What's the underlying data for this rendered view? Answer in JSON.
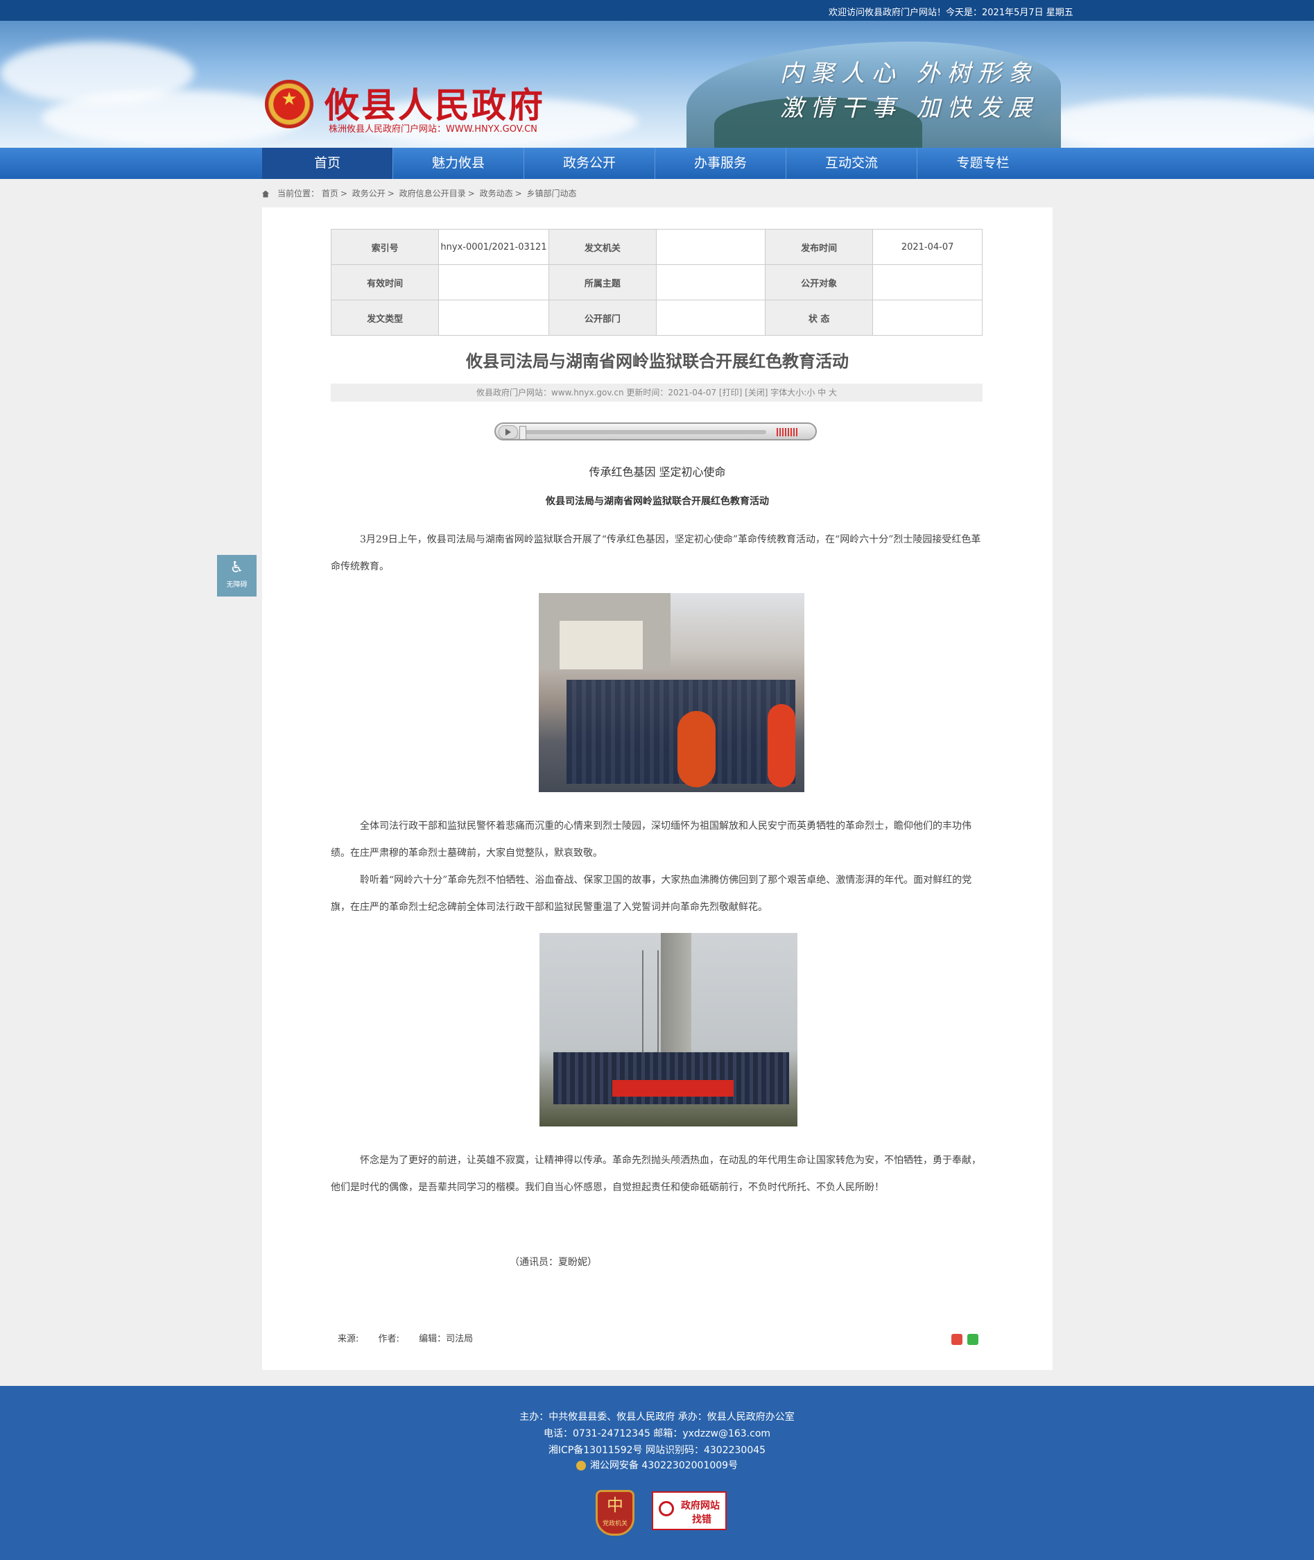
{
  "topbar": {
    "welcome": "欢迎访问攸县政府门户网站！今天是：2021年5月7日 星期五"
  },
  "header": {
    "site_name": "攸县人民政府",
    "site_sub": "株洲攸县人民政府门户网站：WWW.HNYX.GOV.CN",
    "slogan1": "内聚人心 外树形象",
    "slogan2": "激情干事 加快发展"
  },
  "nav": {
    "items": [
      "首页",
      "魅力攸县",
      "政务公开",
      "办事服务",
      "互动交流",
      "专题专栏"
    ]
  },
  "breadcrumb": {
    "label": "当前位置：",
    "items": [
      "首页",
      "政务公开",
      "政府信息公开目录",
      "政务动态",
      "乡镇部门动态"
    ]
  },
  "meta": {
    "k1": "索引号",
    "v1": "hnyx-0001/2021-03121",
    "k2": "发文机关",
    "v2": "",
    "k3": "发布时间",
    "v3": "2021-04-07",
    "k4": "有效时间",
    "v4": "",
    "k5": "所属主题",
    "v5": "",
    "k6": "公开对象",
    "v6": "",
    "k7": "发文类型",
    "v7": "",
    "k8": "公开部门",
    "v8": "",
    "k9": "状 态",
    "v9": ""
  },
  "article": {
    "title": "攸县司法局与湖南省网岭监狱联合开展红色教育活动",
    "infobar": "攸县政府门户网站：www.hnyx.gov.cn  更新时间：2021-04-07  [打印] [关闭]  字体大小:小 中 大",
    "subtitle1": "传承红色基因 坚定初心使命",
    "subtitle2": "攸县司法局与湖南省网岭监狱联合开展红色教育活动",
    "p1": "3月29日上午，攸县司法局与湖南省网岭监狱联合开展了“传承红色基因，坚定初心使命”革命传统教育活动，在“网岭六十分”烈士陵园接受红色革命传统教育。",
    "p2": "全体司法行政干部和监狱民警怀着悲痛而沉重的心情来到烈士陵园，深切缅怀为祖国解放和人民安宁而英勇牺牲的革命烈士，瞻仰他们的丰功伟绩。在庄严肃穆的革命烈士墓碑前，大家自觉整队，默哀致敬。",
    "p3": "聆听着“网岭六十分”革命先烈不怕牺牲、浴血奋战、保家卫国的故事，大家热血沸腾仿佛回到了那个艰苦卓绝、激情澎湃的年代。面对鲜红的党旗，在庄严的革命烈士纪念碑前全体司法行政干部和监狱民警重温了入党誓词并向革命先烈敬献鲜花。",
    "p4": "怀念是为了更好的前进，让英雄不寂寞，让精神得以传承。革命先烈抛头颅洒热血，在动乱的年代用生命让国家转危为安，不怕牺牲，勇于奉献，他们是时代的偶像，是吾辈共同学习的楷模。我们自当心怀感恩，自觉担起责任和使命砥砺前行，不负时代所托、不负人民所盼！",
    "reporter": "（通讯员：夏盼妮）",
    "source": "来源:",
    "author": "作者:",
    "editor": "编辑：司法局"
  },
  "accessibility": {
    "label": "无障碍"
  },
  "footer": {
    "line1": "主办：中共攸县县委、攸县人民政府 承办：攸县人民政府办公室",
    "line2": "电话：0731-24712345 邮箱：yxdzzw@163.com",
    "line3": "湘ICP备13011592号   网站识别码：4302230045",
    "line4": "湘公网安备 43022302001009号",
    "badge1": "党政机关",
    "badge2_line1": "政府网站",
    "badge2_line2": "找错"
  },
  "colors": {
    "nav_blue": "#2a6cc4",
    "footer_blue": "#2a63ab",
    "title_red": "#c8161d"
  }
}
